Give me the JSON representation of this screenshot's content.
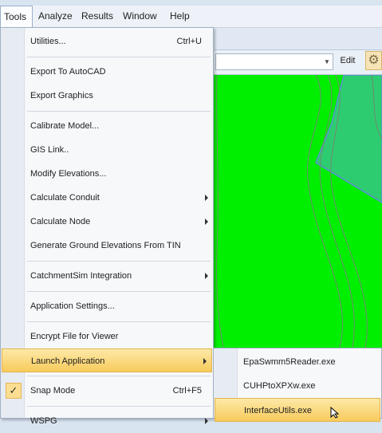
{
  "menubar": {
    "items": [
      {
        "label": "Tools",
        "active": true
      },
      {
        "label": "Analyze"
      },
      {
        "label": "Results"
      },
      {
        "label": "Window"
      },
      {
        "label": "Help"
      }
    ]
  },
  "toolbar": {
    "combo_value": "",
    "edit_label": "Edit",
    "gear_icon": "gear-icon"
  },
  "tools_menu": {
    "items": [
      {
        "label": "Utilities...",
        "shortcut": "Ctrl+U"
      },
      {
        "label": "Export To AutoCAD"
      },
      {
        "label": "Export Graphics"
      },
      {
        "label": "Calibrate Model..."
      },
      {
        "label": "GIS Link.."
      },
      {
        "label": "Modify Elevations..."
      },
      {
        "label": "Calculate Conduit",
        "submenu": true
      },
      {
        "label": "Calculate Node",
        "submenu": true
      },
      {
        "label": "Generate Ground Elevations From TIN"
      },
      {
        "label": "CatchmentSim Integration",
        "submenu": true
      },
      {
        "label": "Application Settings..."
      },
      {
        "label": "Encrypt File for Viewer"
      },
      {
        "label": "Launch Application",
        "submenu": true,
        "highlighted": true
      },
      {
        "label": "Snap Mode",
        "shortcut": "Ctrl+F5",
        "checked": true
      },
      {
        "label": "WSPG",
        "submenu": true
      }
    ]
  },
  "launch_submenu": {
    "items": [
      {
        "label": "EpaSwmm5Reader.exe"
      },
      {
        "label": "CUHPtoXPXw.exe"
      },
      {
        "label": "InterfaceUtils.exe",
        "highlighted": true
      }
    ]
  },
  "colors": {
    "map_background": "#00ee00",
    "polygon_fill": "#2ecc71",
    "highlight": "#f8cb5c"
  }
}
